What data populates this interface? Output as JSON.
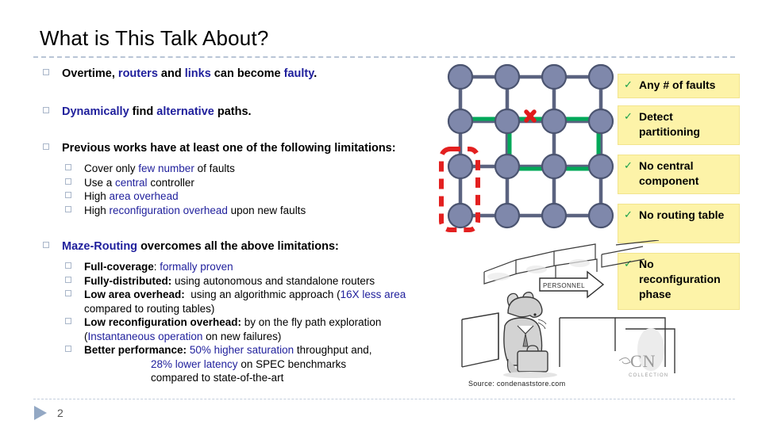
{
  "slide": {
    "title": "What is This Talk About?",
    "page_number": "2",
    "source_credit": "Source: condenaststore.com"
  },
  "bullets": [
    {
      "level": 1,
      "id": "bullet-overtime",
      "runs": [
        {
          "text": "Overtime, ",
          "style": "bold-black"
        },
        {
          "text": "routers",
          "style": "bold-blue"
        },
        {
          "text": " and ",
          "style": "bold-black"
        },
        {
          "text": "links",
          "style": "bold-blue"
        },
        {
          "text": " can become ",
          "style": "bold-black"
        },
        {
          "text": "faulty",
          "style": "bold-blue"
        },
        {
          "text": ".",
          "style": "bold-black"
        }
      ]
    },
    {
      "level": 1,
      "id": "bullet-dynamically",
      "runs": [
        {
          "text": "Dynamically",
          "style": "bold-blue"
        },
        {
          "text": " find ",
          "style": "bold-black"
        },
        {
          "text": "alternative",
          "style": "bold-blue"
        },
        {
          "text": " paths.",
          "style": "bold-black"
        }
      ]
    },
    {
      "level": 1,
      "id": "bullet-previous-works",
      "runs": [
        {
          "text": "Previous works have at least one of the following limitations:",
          "style": "bold-black"
        }
      ]
    },
    {
      "level": 2,
      "id": "bullet-cover-few-faults",
      "runs": [
        {
          "text": "Cover only ",
          "style": "black"
        },
        {
          "text": "few number",
          "style": "blue"
        },
        {
          "text": " of faults",
          "style": "black"
        }
      ]
    },
    {
      "level": 2,
      "id": "bullet-central-controller",
      "runs": [
        {
          "text": "Use a ",
          "style": "black"
        },
        {
          "text": "central",
          "style": "blue"
        },
        {
          "text": " controller",
          "style": "black"
        }
      ]
    },
    {
      "level": 2,
      "id": "bullet-high-area-overhead",
      "runs": [
        {
          "text": "High ",
          "style": "black"
        },
        {
          "text": "area overhead",
          "style": "blue"
        }
      ]
    },
    {
      "level": 2,
      "id": "bullet-high-reconfiguration-overhead",
      "runs": [
        {
          "text": "High ",
          "style": "black"
        },
        {
          "text": "reconfiguration overhead",
          "style": "blue"
        },
        {
          "text": " upon new faults",
          "style": "black"
        }
      ]
    },
    {
      "level": 1,
      "id": "bullet-maze-routing",
      "runs": [
        {
          "text": "Maze-Routing",
          "style": "bold-blue"
        },
        {
          "text": " overcomes all the above limitations:",
          "style": "bold-black"
        }
      ]
    },
    {
      "level": 2,
      "id": "bullet-full-coverage",
      "runs": [
        {
          "text": "Full-coverage",
          "style": "bold-black"
        },
        {
          "text": ": ",
          "style": "black"
        },
        {
          "text": "formally proven",
          "style": "blue"
        }
      ]
    },
    {
      "level": 2,
      "id": "bullet-fully-distributed",
      "runs": [
        {
          "text": "Fully-distributed:",
          "style": "bold-black"
        },
        {
          "text": " using autonomous and standalone routers",
          "style": "black"
        }
      ]
    },
    {
      "level": 2,
      "id": "bullet-low-area-overhead",
      "runs": [
        {
          "text": "Low area overhead:",
          "style": "bold-black"
        },
        {
          "text": "  using an algorithmic approach (",
          "style": "black"
        },
        {
          "text": "16X less area",
          "style": "blue"
        },
        {
          "text": " compared to routing tables)",
          "style": "black"
        }
      ]
    },
    {
      "level": 2,
      "id": "bullet-low-reconfiguration-overhead",
      "runs": [
        {
          "text": "Low reconfiguration overhead:",
          "style": "bold-black"
        },
        {
          "text": " by on the fly path exploration (",
          "style": "black"
        },
        {
          "text": "Instantaneous operation",
          "style": "blue"
        },
        {
          "text": " on new failures)",
          "style": "black"
        }
      ]
    },
    {
      "level": 2,
      "id": "bullet-better-performance",
      "runs": [
        {
          "text": "Better performance:",
          "style": "bold-black"
        },
        {
          "text": " ",
          "style": "black"
        },
        {
          "text": "50% higher saturation",
          "style": "blue"
        },
        {
          "text": " throughput and,",
          "style": "black"
        }
      ],
      "continuation": [
        [
          {
            "text": "28% lower latency",
            "style": "blue"
          },
          {
            "text": " on SPEC benchmarks",
            "style": "black"
          }
        ],
        [
          {
            "text": "compared to state-of-the-art",
            "style": "black"
          }
        ]
      ]
    }
  ],
  "callouts": [
    {
      "id": "callout-any-faults",
      "icon": "check-icon",
      "label": "Any # of faults"
    },
    {
      "id": "callout-detect-partitioning",
      "icon": "check-icon",
      "label": "Detect partitioning"
    },
    {
      "id": "callout-no-central",
      "icon": "check-icon",
      "label": "No central component"
    },
    {
      "id": "callout-no-routing-table",
      "icon": "check-icon",
      "label": "No routing table"
    },
    {
      "id": "callout-no-reconfig-phase",
      "icon": "check-icon",
      "label": "No reconfiguration phase"
    }
  ],
  "mesh": {
    "rows": 4,
    "cols": 4,
    "node_color": "#7f88ab",
    "node_stroke": "#4b5470",
    "link_color": "#5b6380",
    "path_color": "#00a859",
    "fault_color": "#e01b1b",
    "partition_color": "#e32020",
    "fault_marker": "x-mark",
    "partition_marker": "dashed-rounded-rect",
    "path_nodes": [
      "r2c1",
      "r2c2",
      "r2c3",
      "r2c4",
      "r3c4",
      "r3c3",
      "r3c2"
    ]
  },
  "cartoon": {
    "sign_label": "PERSONNEL",
    "watermark": "CN",
    "watermark_sub": "COLLECTION"
  },
  "colors": {
    "accent_blue": "#1f1f9c",
    "callout_bg": "#fdf3a8",
    "callout_border": "#f2e48e",
    "check_green": "#18a04a",
    "rule_gray": "#b9c5d6",
    "bullet_square": "#a9b6c9"
  }
}
